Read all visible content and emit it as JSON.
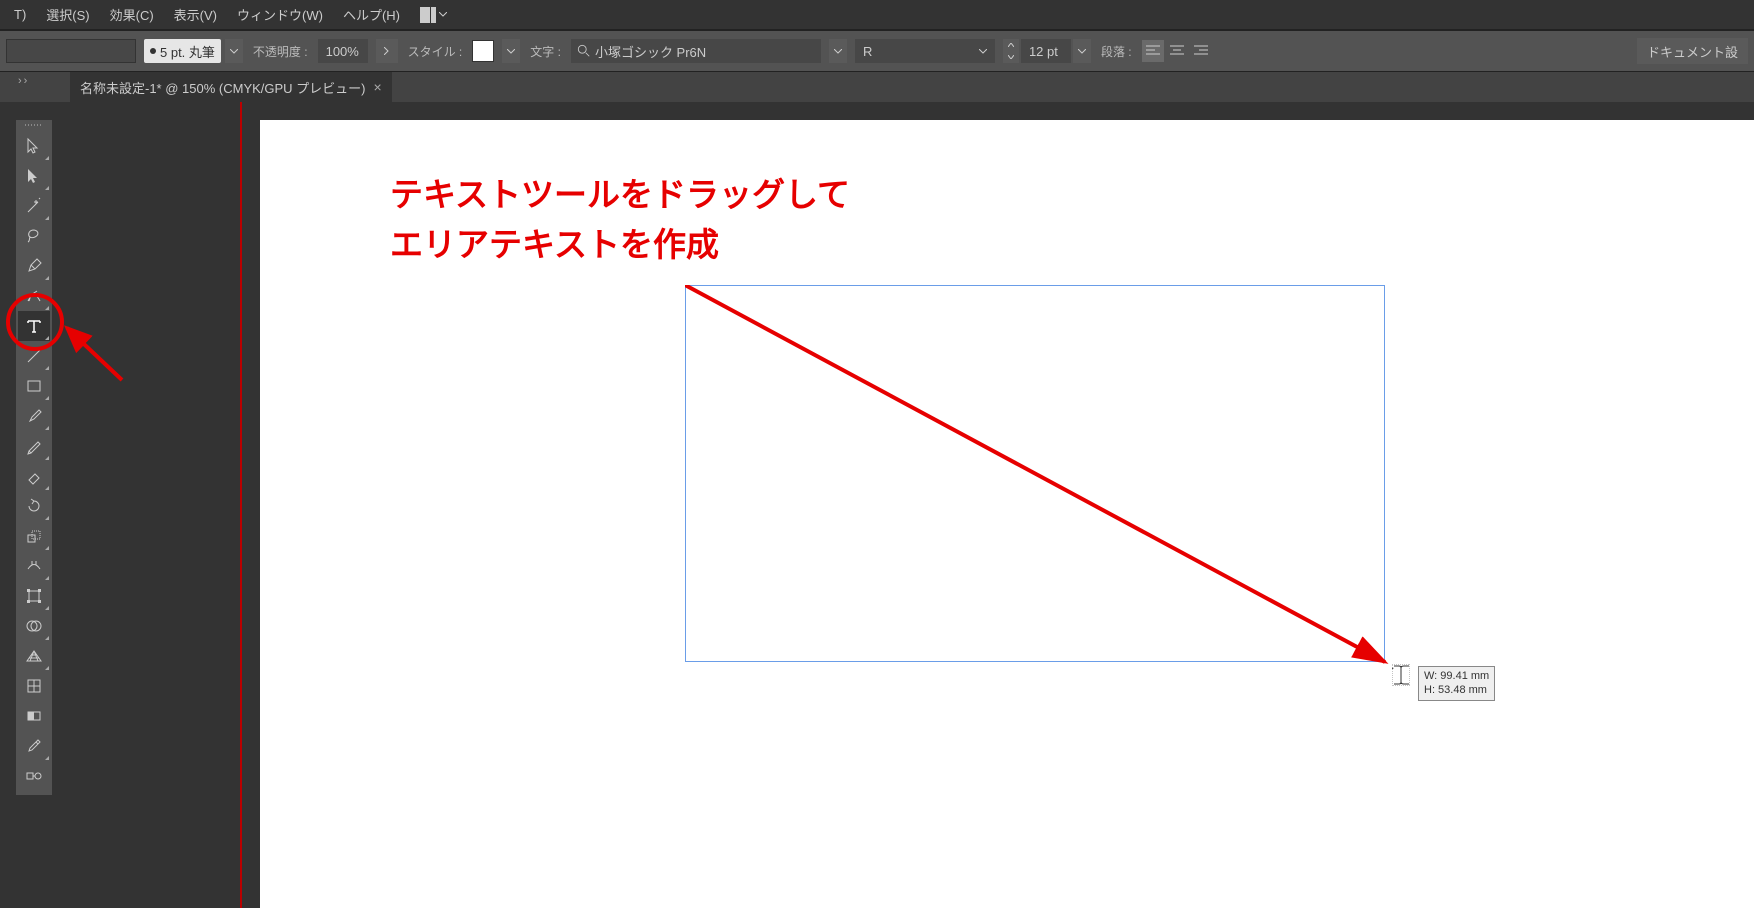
{
  "menubar": {
    "items": [
      "T)",
      "選択(S)",
      "効果(C)",
      "表示(V)",
      "ウィンドウ(W)",
      "ヘルプ(H)"
    ]
  },
  "options": {
    "stroke_value": "5 pt. 丸筆",
    "opacity_label": "不透明度 :",
    "opacity_value": "100%",
    "style_label": "スタイル :",
    "char_label": "文字 :",
    "font_name": "小塚ゴシック Pr6N",
    "font_style": "R",
    "font_size": "12 pt",
    "para_label": "段落 :",
    "doc_setup": "ドキュメント設"
  },
  "tab": {
    "title": "名称未設定-1* @ 150% (CMYK/GPU プレビュー)"
  },
  "annotation": {
    "line1": "テキストツールをドラッグして",
    "line2": "エリアテキストを作成"
  },
  "tooltip": {
    "w": "W: 99.41 mm",
    "h": "H: 53.48 mm"
  }
}
